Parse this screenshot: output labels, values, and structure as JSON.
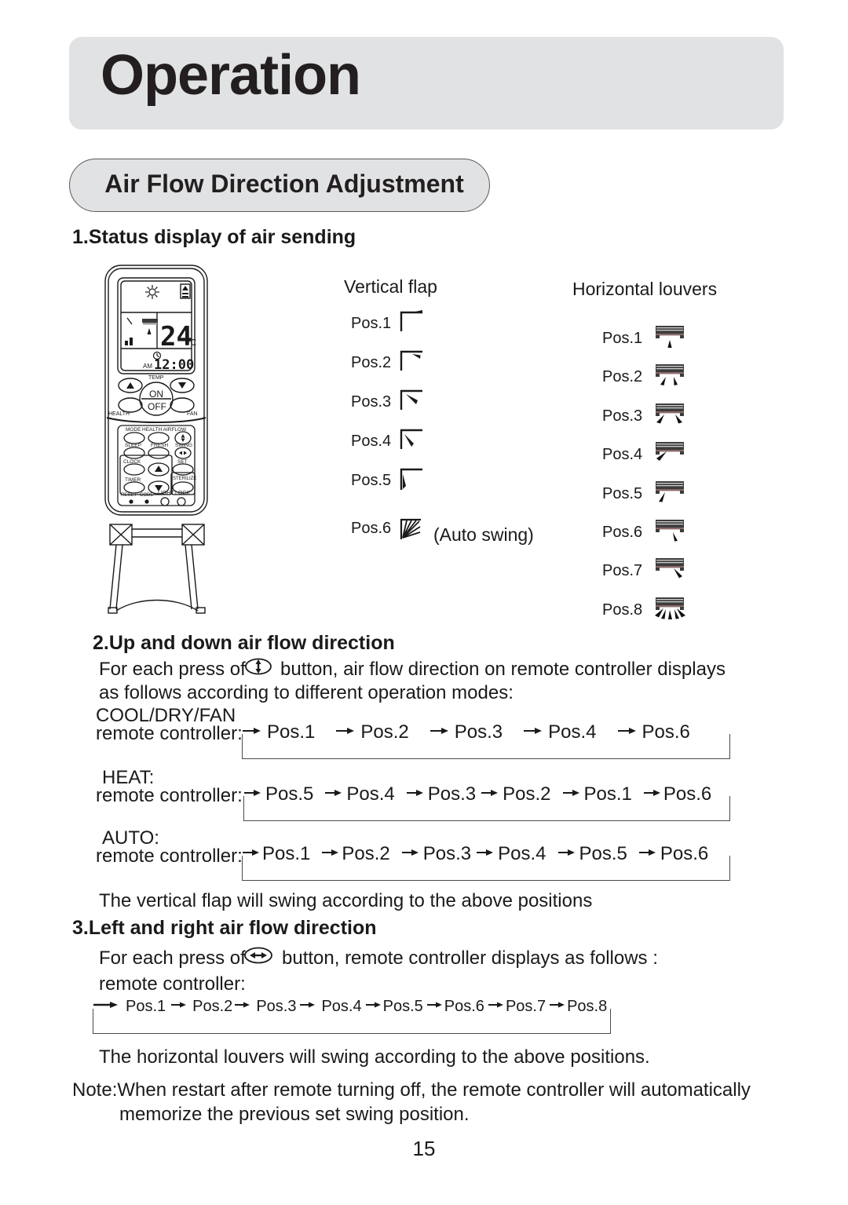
{
  "header": {
    "chapter_title": "Operation",
    "section_title": "Air Flow Direction Adjustment",
    "banner_color": "#e1e2e4",
    "text_color": "#231f20"
  },
  "section1": {
    "heading": "1.Status display of air sending",
    "vertical_flap": {
      "column_title": "Vertical flap",
      "positions": [
        {
          "label": "Pos.1",
          "icon": "flap-pos1-icon",
          "note": ""
        },
        {
          "label": "Pos.2",
          "icon": "flap-pos2-icon",
          "note": ""
        },
        {
          "label": "Pos.3",
          "icon": "flap-pos3-icon",
          "note": ""
        },
        {
          "label": "Pos.4",
          "icon": "flap-pos4-icon",
          "note": ""
        },
        {
          "label": "Pos.5",
          "icon": "flap-pos5-icon",
          "note": ""
        },
        {
          "label": "Pos.6",
          "icon": "flap-pos6-auto-swing-icon",
          "note": "(Auto swing)"
        }
      ]
    },
    "horizontal_louvers": {
      "column_title": "Horizontal louvers",
      "positions": [
        {
          "label": "Pos.1",
          "icon": "louver-pos1-icon"
        },
        {
          "label": "Pos.2",
          "icon": "louver-pos2-icon"
        },
        {
          "label": "Pos.3",
          "icon": "louver-pos3-icon"
        },
        {
          "label": "Pos.4",
          "icon": "louver-pos4-icon"
        },
        {
          "label": "Pos.5",
          "icon": "louver-pos5-icon"
        },
        {
          "label": "Pos.6",
          "icon": "louver-pos6-icon"
        },
        {
          "label": "Pos.7",
          "icon": "louver-pos7-icon"
        },
        {
          "label": "Pos.8",
          "icon": "louver-pos8-icon"
        }
      ]
    }
  },
  "remote": {
    "display": {
      "temperature": "24",
      "temperature_unit": "C",
      "clock_meridiem": "AM",
      "clock_time": "12:00"
    },
    "labels": {
      "temp": "TEMP",
      "on": "ON",
      "off": "OFF",
      "health": "HEALTH",
      "fan": "FAN",
      "mode": "MODE",
      "health_airflow": "HEALTH AIRFLOW",
      "sleep": "SLEEP",
      "fresh": "FRESH",
      "swing": "SWING",
      "clock": "CLOCK",
      "set": "SET",
      "timer": "TIMER",
      "sterilize": "STERILIZE",
      "reset": "RESET",
      "code": "CODE",
      "light": "LIGHT",
      "lock": "LOCK"
    }
  },
  "section2": {
    "heading": "2.Up and down air flow direction",
    "intro_line1_before_icon": "For each press of",
    "button_icon": "up-down-swing-button-icon",
    "intro_line1_after_icon": "button, air flow direction on remote controller displays",
    "intro_line2": "as follows according to different operation modes:",
    "rc_label": "remote controller:",
    "modes": [
      {
        "name": "COOL/DRY/FAN",
        "sequence": [
          "Pos.1",
          "Pos.2",
          "Pos.3",
          "Pos.4",
          "Pos.6"
        ]
      },
      {
        "name": "HEAT:",
        "sequence": [
          "Pos.5",
          "Pos.4",
          "Pos.3",
          "Pos.2",
          "Pos.1",
          "Pos.6"
        ]
      },
      {
        "name": "AUTO:",
        "sequence": [
          "Pos.1",
          "Pos.2",
          "Pos.3",
          "Pos.4",
          "Pos.5",
          "Pos.6"
        ]
      }
    ],
    "footnote": "The vertical flap will swing according to the above positions"
  },
  "section3": {
    "heading": "3.Left and right air flow direction",
    "intro_before_icon": "For each press of",
    "button_icon": "left-right-swing-button-icon",
    "intro_after_icon": "button, remote controller displays as follows :",
    "rc_label": "remote controller:",
    "sequence": [
      "Pos.1",
      "Pos.2",
      "Pos.3",
      "Pos.4",
      "Pos.5",
      "Pos.6",
      "Pos.7",
      "Pos.8"
    ],
    "footnote": "The horizontal louvers will swing according to the above positions."
  },
  "note": {
    "line1": "Note:When restart after remote turning off, the remote controller will automatically",
    "line2": "memorize the previous set swing position."
  },
  "footer": {
    "page_number": "15"
  }
}
